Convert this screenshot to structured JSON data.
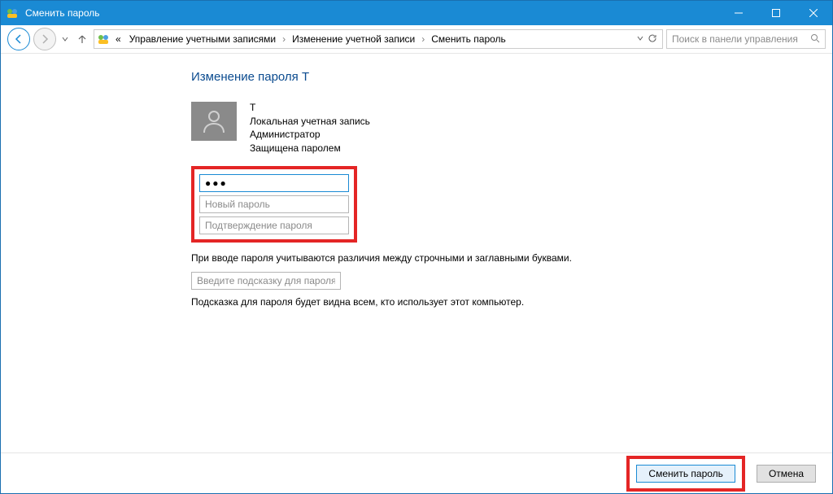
{
  "titlebar": {
    "title": "Сменить пароль"
  },
  "breadcrumb": {
    "prefix": "«",
    "items": [
      "Управление учетными записями",
      "Изменение учетной записи",
      "Сменить пароль"
    ]
  },
  "search": {
    "placeholder": "Поиск в панели управления"
  },
  "heading": "Изменение пароля T",
  "user": {
    "name": "T",
    "type": "Локальная учетная запись",
    "role": "Администратор",
    "protection": "Защищена паролем"
  },
  "fields": {
    "current_value": "●●●",
    "new_placeholder": "Новый пароль",
    "confirm_placeholder": "Подтверждение пароля",
    "hint_placeholder": "Введите подсказку для пароля"
  },
  "notes": {
    "case": "При вводе пароля учитываются различия между строчными и заглавными буквами.",
    "hint": "Подсказка для пароля будет видна всем, кто использует этот компьютер."
  },
  "buttons": {
    "submit": "Сменить пароль",
    "cancel": "Отмена"
  }
}
